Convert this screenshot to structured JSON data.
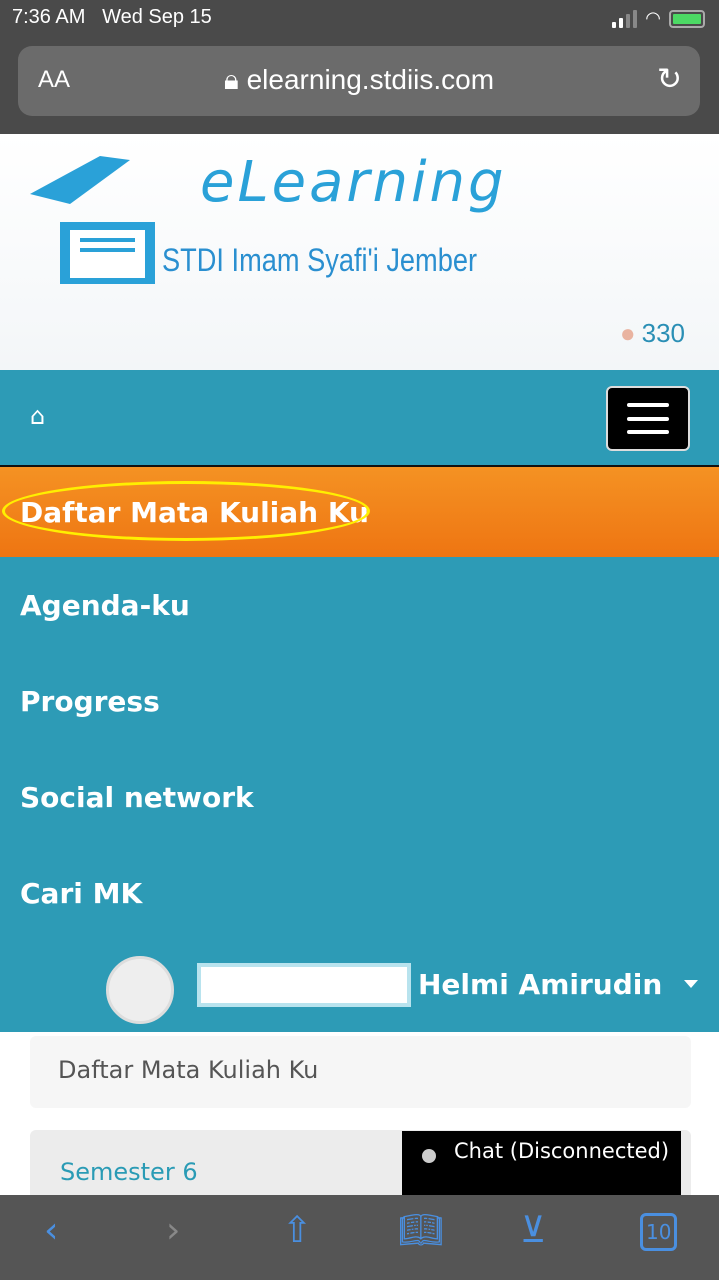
{
  "status_bar": {
    "time": "7:36 AM",
    "date": "Wed Sep 15"
  },
  "browser": {
    "text_size": "AA",
    "url": "elearning.stdiis.com",
    "tab_count": "10"
  },
  "logo": {
    "title": "eLearning",
    "subtitle": "STDI Imam Syafi'i Jember"
  },
  "online_count": "330",
  "nav": {
    "items": [
      {
        "label": "Daftar Mata Kuliah Ku",
        "active": true
      },
      {
        "label": "Agenda-ku"
      },
      {
        "label": "Progress"
      },
      {
        "label": "Social network"
      },
      {
        "label": "Cari MK"
      }
    ],
    "user_name": "Helmi Amirudin"
  },
  "breadcrumb": "Daftar Mata Kuliah Ku",
  "semester": "Semester 6",
  "chat": "Chat (Disconnected)",
  "colors": {
    "nav": "#2d9bb6",
    "active": "#f28420",
    "highlight": "#ffef00"
  }
}
